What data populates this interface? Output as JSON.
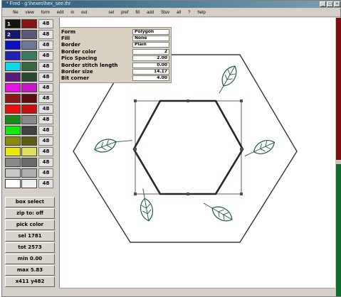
{
  "window": {
    "title": "* Fred - g:\\hexes\\hex_see.thr"
  },
  "titlebar_buttons": [
    "_",
    "□",
    "×"
  ],
  "menu": [
    "file",
    "view",
    "form",
    "edit",
    "in",
    "out",
    "",
    "",
    "sel",
    "pref",
    "fill",
    "add",
    "Stuv",
    "all",
    "?",
    "help"
  ],
  "palette": [
    {
      "c1": "#141414",
      "c2": "#8a1414",
      "num": "1",
      "value": "48"
    },
    {
      "c1": "#18186a",
      "c2": "#5a5a78",
      "num": "2",
      "value": "48"
    },
    {
      "c1": "#0a10c0",
      "c2": "#70789a",
      "num": "",
      "value": "48"
    },
    {
      "c1": "#2222b0",
      "c2": "#3c7a60",
      "num": "",
      "value": "48"
    },
    {
      "c1": "#10d8e8",
      "c2": "#386840",
      "num": "",
      "value": "48"
    },
    {
      "c1": "#5a1c7a",
      "c2": "#284a30",
      "num": "",
      "value": "48"
    },
    {
      "c1": "#e810e8",
      "c2": "#c818c8",
      "num": "",
      "value": "48"
    },
    {
      "c1": "#8a1a1a",
      "c2": "#5a0e0e",
      "num": "",
      "value": "48"
    },
    {
      "c1": "#e81010",
      "c2": "#c81010",
      "num": "",
      "value": "48"
    },
    {
      "c1": "#1a8a1a",
      "c2": "#8a8a8a",
      "num": "",
      "value": "48"
    },
    {
      "c1": "#10e810",
      "c2": "#404040",
      "num": "",
      "value": "48"
    },
    {
      "c1": "#8a8a10",
      "c2": "#5a5a10",
      "num": "",
      "value": "48"
    },
    {
      "c1": "#e8e810",
      "c2": "#e0e060",
      "num": "",
      "value": "48"
    },
    {
      "c1": "#8a8a8a",
      "c2": "#6a6a6a",
      "num": "",
      "value": "48"
    },
    {
      "c1": "#c8c8c8",
      "c2": "#b0b0b0",
      "num": "",
      "value": "48"
    },
    {
      "c1": "#ffffff",
      "c2": "#f0f0f0",
      "num": "",
      "value": "48"
    }
  ],
  "tools": [
    "box select",
    "zip to: off",
    "pick color",
    "sel 1781",
    "tot 2573",
    "min 0.00",
    "max 5.83",
    "x411 y482"
  ],
  "properties": [
    {
      "label": "Form",
      "value": "Polygon",
      "is_text": true
    },
    {
      "label": "Fill",
      "value": "None",
      "is_text": true
    },
    {
      "label": "Border",
      "value": "Plain",
      "is_text": true
    },
    {
      "label": "Border color",
      "value": "2",
      "is_text": false
    },
    {
      "label": "Pico Spacing",
      "value": "2.00",
      "is_text": false
    },
    {
      "label": "Border stitch length",
      "value": "0.00",
      "is_text": false
    },
    {
      "label": "Border size",
      "value": "14.17",
      "is_text": false
    },
    {
      "label": "Bit corner",
      "value": "4.00",
      "is_text": false
    }
  ],
  "colors": {
    "canvas_bg": "#ffffff",
    "outline": "#303830",
    "leaf": "#1e5a3a",
    "selection": "#7a6470",
    "right_bar_top": "#7a1010",
    "right_bar_bottom": "#0e6a2a"
  }
}
